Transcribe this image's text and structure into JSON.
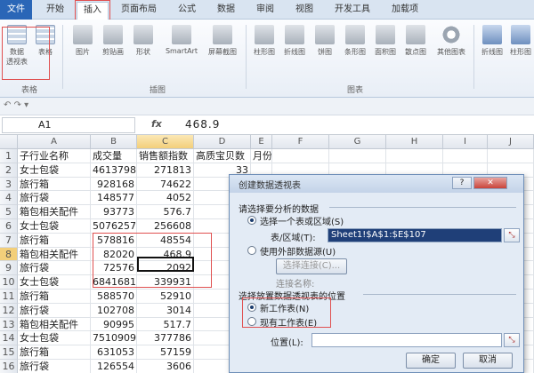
{
  "ribbon": {
    "tabs": [
      "文件",
      "开始",
      "插入",
      "页面布局",
      "公式",
      "数据",
      "审阅",
      "视图",
      "开发工具",
      "加载项"
    ],
    "active_tab": "插入",
    "buttons": [
      {
        "label": "数据\n透视表",
        "icon": "pivot-table-icon"
      },
      {
        "label": "表格",
        "icon": "table-icon"
      },
      {
        "label": "图片",
        "icon": "picture-icon"
      },
      {
        "label": "剪贴画",
        "icon": "clipart-icon"
      },
      {
        "label": "形状",
        "icon": "shapes-icon"
      },
      {
        "label": "SmartArt",
        "icon": "smartart-icon"
      },
      {
        "label": "屏幕截图",
        "icon": "screenshot-icon"
      },
      {
        "label": "柱形图",
        "icon": "column-chart-icon"
      },
      {
        "label": "折线图",
        "icon": "line-chart-icon"
      },
      {
        "label": "饼图",
        "icon": "pie-chart-icon"
      },
      {
        "label": "条形图",
        "icon": "bar-chart-icon"
      },
      {
        "label": "面积图",
        "icon": "area-chart-icon"
      },
      {
        "label": "散点图",
        "icon": "scatter-chart-icon"
      },
      {
        "label": "其他图表",
        "icon": "other-chart-icon"
      },
      {
        "label": "折线图",
        "icon": "sparkline-line-icon"
      },
      {
        "label": "柱形图",
        "icon": "sparkline-column-icon"
      }
    ],
    "groups": [
      "表格",
      "插图",
      "图表"
    ]
  },
  "formula_bar": {
    "name_box": "A1",
    "fx": "fx",
    "value": "468.9"
  },
  "sheet": {
    "columns": [
      "A",
      "B",
      "C",
      "D",
      "E",
      "F",
      "G",
      "H",
      "I",
      "J"
    ],
    "rows": [
      [
        "子行业名称",
        "成交量",
        "销售额指数",
        "高质宝贝数",
        "月份"
      ],
      [
        "女士包袋",
        "4613798",
        "271813",
        "33",
        ""
      ],
      [
        "旅行箱",
        "928168",
        "74622",
        "1",
        ""
      ],
      [
        "旅行袋",
        "148577",
        "4052",
        "",
        ""
      ],
      [
        "箱包相关配件",
        "93773",
        "576.7",
        "",
        ""
      ],
      [
        "女士包袋",
        "5076257",
        "256608",
        "33",
        ""
      ],
      [
        "旅行箱",
        "578816",
        "48554",
        "",
        ""
      ],
      [
        "箱包相关配件",
        "82020",
        "468.9",
        "",
        ""
      ],
      [
        "旅行袋",
        "72576",
        "2092",
        "",
        ""
      ],
      [
        "女士包袋",
        "6841681",
        "339931",
        "",
        ""
      ],
      [
        "旅行箱",
        "588570",
        "52910",
        "",
        ""
      ],
      [
        "旅行袋",
        "102708",
        "3014",
        "",
        ""
      ],
      [
        "箱包相关配件",
        "90995",
        "517.7",
        "",
        ""
      ],
      [
        "女士包袋",
        "7510909",
        "377786",
        "",
        ""
      ],
      [
        "旅行箱",
        "631053",
        "57159",
        "",
        ""
      ],
      [
        "旅行袋",
        "126554",
        "3606",
        "",
        ""
      ]
    ]
  },
  "dialog": {
    "title": "创建数据透视表",
    "section1": "请选择要分析的数据",
    "opt_select_range": "选择一个表或区域(S)",
    "range_label": "表/区域(T):",
    "range_value": "Sheet1!$A$1:$E$107",
    "opt_external": "使用外部数据源(U)",
    "choose_conn": "选择连接(C)...",
    "conn_name": "连接名称:",
    "section2": "选择放置数据透视表的位置",
    "opt_new_sheet": "新工作表(N)",
    "opt_existing": "现有工作表(E)",
    "location_label": "位置(L):",
    "location_value": "",
    "ok": "确定",
    "cancel": "取消"
  },
  "colors": {
    "accent": "#2a66b7",
    "highlight_box": "#e05050"
  }
}
